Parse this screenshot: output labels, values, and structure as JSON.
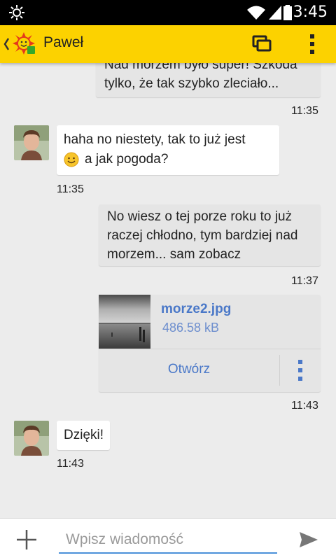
{
  "status_bar": {
    "time": "13:45",
    "icons": [
      "app-notification-icon",
      "wifi-icon",
      "signal-icon",
      "battery-icon"
    ]
  },
  "app_bar": {
    "title": "Paweł",
    "icons": [
      "back-chevron-icon",
      "app-logo-icon",
      "switch-window-icon",
      "overflow-menu-icon"
    ],
    "accent_color": "#fcd200"
  },
  "messages": [
    {
      "direction": "outgoing",
      "lines": [
        "Nad morzem było super! Szkoda",
        "tylko, że tak szybko zleciało..."
      ],
      "time": "11:35"
    },
    {
      "direction": "incoming",
      "lines": [
        "haha no niestety, tak to już jest",
        "a jak pogoda?"
      ],
      "emoji": "smile-emoji-icon",
      "time": "11:35"
    },
    {
      "direction": "outgoing",
      "lines": [
        "No wiesz o tej porze roku to już",
        "raczej chłodno, tym bardziej nad",
        "morzem... sam zobacz"
      ],
      "time": "11:37"
    },
    {
      "direction": "outgoing",
      "type": "file",
      "file": {
        "name": "morze2.jpg",
        "size": "486.58 kB",
        "open_label": "Otwórz",
        "link_color": "#4a78c8"
      },
      "time": "11:43"
    },
    {
      "direction": "incoming",
      "lines": [
        "Dzięki!"
      ],
      "time": "11:43"
    }
  ],
  "composer": {
    "placeholder": "Wpisz wiadomość",
    "value": "",
    "icons": [
      "add-icon",
      "send-icon"
    ]
  }
}
